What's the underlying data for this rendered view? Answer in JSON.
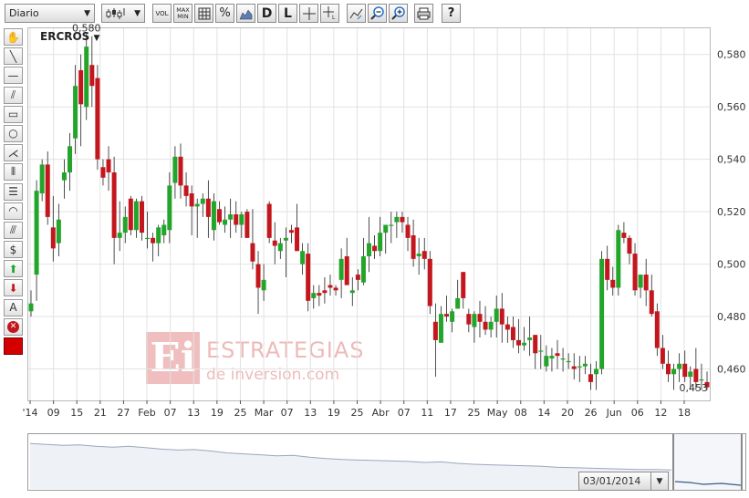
{
  "toolbar": {
    "period_select": "Diario",
    "vol": "VOL",
    "maxmin": "MAX MIN",
    "percent": "%",
    "d": "D",
    "l": "L",
    "help": "?"
  },
  "sidebar_tools": [
    {
      "icon": "hand-icon",
      "glyph": "✋"
    },
    {
      "icon": "trendline-icon",
      "glyph": "╲"
    },
    {
      "icon": "horizontal-line-icon",
      "glyph": "—"
    },
    {
      "icon": "channel-icon",
      "glyph": "⫽"
    },
    {
      "icon": "rectangle-icon",
      "glyph": "▭"
    },
    {
      "icon": "circle-icon",
      "glyph": "○"
    },
    {
      "icon": "pitchfork-icon",
      "glyph": "⋌"
    },
    {
      "icon": "fibonacci-fan-icon",
      "glyph": "⦀"
    },
    {
      "icon": "fibonacci-retracement-icon",
      "glyph": "☰"
    },
    {
      "icon": "arc-icon",
      "glyph": "◠"
    },
    {
      "icon": "parallel-lines-icon",
      "glyph": "⫻"
    },
    {
      "icon": "dollar-lines-icon",
      "glyph": "$"
    },
    {
      "icon": "buy-arrow-icon",
      "glyph": "⬆"
    },
    {
      "icon": "sell-arrow-icon",
      "glyph": "⬇"
    },
    {
      "icon": "text-tool-icon",
      "glyph": "A"
    },
    {
      "icon": "delete-icon",
      "glyph": "✕"
    },
    {
      "icon": "color-picker-icon",
      "glyph": ""
    }
  ],
  "ticker": "ERCROS",
  "watermark": {
    "box": "Ei",
    "line1": "ESTRATEGIAS",
    "line2": "de inversion.com"
  },
  "colors": {
    "up": "#22a52a",
    "down": "#c3161d",
    "grid": "#e2e2e2"
  },
  "chart_data": {
    "type": "candlestick",
    "title": "ERCROS",
    "ylim": [
      0.448,
      0.59
    ],
    "y_ticks": [
      "0,580",
      "0,560",
      "0,540",
      "0,520",
      "0,500",
      "0,480",
      "0,460"
    ],
    "x_labels": [
      "'14",
      "09",
      "15",
      "21",
      "27",
      "Feb",
      "07",
      "13",
      "19",
      "25",
      "Mar",
      "07",
      "13",
      "19",
      "25",
      "Abr",
      "07",
      "11",
      "17",
      "25",
      "May",
      "08",
      "14",
      "20",
      "26",
      "Jun",
      "06",
      "12",
      "18"
    ],
    "annotations": {
      "max": "0,580",
      "last": "0,453"
    },
    "candles": [
      [
        0.482,
        0.49,
        0.48,
        0.485
      ],
      [
        0.496,
        0.532,
        0.486,
        0.528
      ],
      [
        0.527,
        0.54,
        0.524,
        0.538
      ],
      [
        0.538,
        0.543,
        0.515,
        0.518
      ],
      [
        0.514,
        0.526,
        0.501,
        0.506
      ],
      [
        0.508,
        0.523,
        0.503,
        0.517
      ],
      [
        0.532,
        0.54,
        0.525,
        0.535
      ],
      [
        0.535,
        0.55,
        0.528,
        0.545
      ],
      [
        0.548,
        0.576,
        0.542,
        0.568
      ],
      [
        0.574,
        0.58,
        0.545,
        0.561
      ],
      [
        0.56,
        0.588,
        0.555,
        0.583
      ],
      [
        0.576,
        0.587,
        0.56,
        0.568
      ],
      [
        0.571,
        0.576,
        0.536,
        0.54
      ],
      [
        0.537,
        0.54,
        0.53,
        0.533
      ],
      [
        0.54,
        0.545,
        0.528,
        0.535
      ],
      [
        0.535,
        0.541,
        0.5,
        0.51
      ],
      [
        0.51,
        0.524,
        0.505,
        0.512
      ],
      [
        0.512,
        0.522,
        0.508,
        0.518
      ],
      [
        0.525,
        0.526,
        0.511,
        0.513
      ],
      [
        0.513,
        0.525,
        0.51,
        0.524
      ],
      [
        0.524,
        0.526,
        0.509,
        0.512
      ],
      [
        0.51,
        0.52,
        0.506,
        0.51
      ],
      [
        0.51,
        0.512,
        0.501,
        0.508
      ],
      [
        0.508,
        0.515,
        0.503,
        0.514
      ],
      [
        0.511,
        0.517,
        0.508,
        0.515
      ],
      [
        0.513,
        0.535,
        0.508,
        0.53
      ],
      [
        0.531,
        0.545,
        0.525,
        0.541
      ],
      [
        0.541,
        0.546,
        0.525,
        0.53
      ],
      [
        0.53,
        0.535,
        0.522,
        0.526
      ],
      [
        0.527,
        0.53,
        0.511,
        0.522
      ],
      [
        0.522,
        0.525,
        0.51,
        0.523
      ],
      [
        0.523,
        0.527,
        0.518,
        0.525
      ],
      [
        0.525,
        0.532,
        0.51,
        0.518
      ],
      [
        0.513,
        0.527,
        0.509,
        0.524
      ],
      [
        0.521,
        0.524,
        0.515,
        0.516
      ],
      [
        0.515,
        0.522,
        0.512,
        0.517
      ],
      [
        0.517,
        0.525,
        0.51,
        0.519
      ],
      [
        0.519,
        0.524,
        0.512,
        0.515
      ],
      [
        0.515,
        0.52,
        0.51,
        0.519
      ],
      [
        0.52,
        0.521,
        0.51,
        0.51
      ],
      [
        0.508,
        0.521,
        0.498,
        0.501
      ],
      [
        0.5,
        0.505,
        0.481,
        0.491
      ],
      [
        0.49,
        0.5,
        0.486,
        0.494
      ],
      [
        0.523,
        0.524,
        0.508,
        0.51
      ],
      [
        0.509,
        0.516,
        0.5,
        0.507
      ],
      [
        0.505,
        0.51,
        0.502,
        0.508
      ],
      [
        0.509,
        0.514,
        0.495,
        0.51
      ],
      [
        0.513,
        0.515,
        0.508,
        0.512
      ],
      [
        0.514,
        0.523,
        0.505,
        0.505
      ],
      [
        0.5,
        0.508,
        0.496,
        0.505
      ],
      [
        0.504,
        0.508,
        0.482,
        0.486
      ],
      [
        0.487,
        0.492,
        0.483,
        0.489
      ],
      [
        0.489,
        0.492,
        0.484,
        0.488
      ],
      [
        0.49,
        0.495,
        0.485,
        0.489
      ],
      [
        0.492,
        0.496,
        0.488,
        0.491
      ],
      [
        0.491,
        0.492,
        0.488,
        0.49
      ],
      [
        0.494,
        0.506,
        0.487,
        0.502
      ],
      [
        0.503,
        0.51,
        0.5,
        0.492
      ],
      [
        0.489,
        0.495,
        0.484,
        0.49
      ],
      [
        0.496,
        0.498,
        0.49,
        0.494
      ],
      [
        0.493,
        0.51,
        0.492,
        0.503
      ],
      [
        0.503,
        0.518,
        0.497,
        0.508
      ],
      [
        0.507,
        0.511,
        0.502,
        0.505
      ],
      [
        0.505,
        0.518,
        0.503,
        0.512
      ],
      [
        0.512,
        0.515,
        0.504,
        0.515
      ],
      [
        0.515,
        0.52,
        0.508,
        0.515
      ],
      [
        0.516,
        0.52,
        0.51,
        0.518
      ],
      [
        0.518,
        0.52,
        0.512,
        0.516
      ],
      [
        0.515,
        0.518,
        0.505,
        0.51
      ],
      [
        0.511,
        0.517,
        0.499,
        0.502
      ],
      [
        0.503,
        0.51,
        0.496,
        0.504
      ],
      [
        0.505,
        0.51,
        0.498,
        0.502
      ],
      [
        0.502,
        0.505,
        0.481,
        0.484
      ],
      [
        0.478,
        0.485,
        0.457,
        0.471
      ],
      [
        0.47,
        0.484,
        0.47,
        0.481
      ],
      [
        0.481,
        0.488,
        0.478,
        0.48
      ],
      [
        0.478,
        0.483,
        0.474,
        0.482
      ],
      [
        0.483,
        0.494,
        0.483,
        0.487
      ],
      [
        0.497,
        0.497,
        0.483,
        0.487
      ],
      [
        0.481,
        0.483,
        0.474,
        0.477
      ],
      [
        0.476,
        0.482,
        0.47,
        0.481
      ],
      [
        0.481,
        0.486,
        0.472,
        0.478
      ],
      [
        0.478,
        0.484,
        0.473,
        0.475
      ],
      [
        0.475,
        0.48,
        0.472,
        0.478
      ],
      [
        0.478,
        0.488,
        0.472,
        0.483
      ],
      [
        0.483,
        0.489,
        0.47,
        0.477
      ],
      [
        0.477,
        0.48,
        0.47,
        0.475
      ],
      [
        0.476,
        0.48,
        0.468,
        0.471
      ],
      [
        0.471,
        0.479,
        0.466,
        0.469
      ],
      [
        0.469,
        0.476,
        0.467,
        0.47
      ],
      [
        0.471,
        0.48,
        0.465,
        0.472
      ],
      [
        0.473,
        0.473,
        0.46,
        0.466
      ],
      [
        0.467,
        0.473,
        0.46,
        0.467
      ],
      [
        0.461,
        0.469,
        0.459,
        0.465
      ],
      [
        0.464,
        0.468,
        0.459,
        0.465
      ],
      [
        0.466,
        0.471,
        0.46,
        0.465
      ],
      [
        0.464,
        0.468,
        0.459,
        0.464
      ],
      [
        0.463,
        0.466,
        0.46,
        0.463
      ],
      [
        0.461,
        0.466,
        0.456,
        0.46
      ],
      [
        0.461,
        0.465,
        0.455,
        0.461
      ],
      [
        0.461,
        0.465,
        0.458,
        0.462
      ],
      [
        0.458,
        0.462,
        0.452,
        0.455
      ],
      [
        0.458,
        0.463,
        0.452,
        0.46
      ],
      [
        0.46,
        0.505,
        0.458,
        0.502
      ],
      [
        0.502,
        0.507,
        0.49,
        0.494
      ],
      [
        0.494,
        0.499,
        0.488,
        0.491
      ],
      [
        0.491,
        0.515,
        0.488,
        0.513
      ],
      [
        0.512,
        0.516,
        0.508,
        0.51
      ],
      [
        0.51,
        0.511,
        0.5,
        0.504
      ],
      [
        0.504,
        0.508,
        0.488,
        0.49
      ],
      [
        0.491,
        0.496,
        0.487,
        0.496
      ],
      [
        0.496,
        0.502,
        0.484,
        0.49
      ],
      [
        0.49,
        0.496,
        0.48,
        0.481
      ],
      [
        0.482,
        0.485,
        0.465,
        0.468
      ],
      [
        0.468,
        0.473,
        0.46,
        0.462
      ],
      [
        0.462,
        0.467,
        0.455,
        0.458
      ],
      [
        0.458,
        0.462,
        0.452,
        0.46
      ],
      [
        0.46,
        0.466,
        0.455,
        0.462
      ],
      [
        0.462,
        0.467,
        0.455,
        0.457
      ],
      [
        0.457,
        0.461,
        0.452,
        0.459
      ],
      [
        0.46,
        0.468,
        0.452,
        0.455
      ],
      [
        0.456,
        0.462,
        0.452,
        0.456
      ],
      [
        0.455,
        0.459,
        0.452,
        0.453
      ]
    ]
  },
  "navigator": {
    "date": "03/01/2014",
    "history": [
      0.92,
      0.9,
      0.88,
      0.89,
      0.86,
      0.84,
      0.86,
      0.83,
      0.8,
      0.78,
      0.79,
      0.76,
      0.72,
      0.7,
      0.68,
      0.66,
      0.67,
      0.63,
      0.6,
      0.58,
      0.57,
      0.56,
      0.55,
      0.54,
      0.52,
      0.53,
      0.5,
      0.48,
      0.47,
      0.46,
      0.45,
      0.44,
      0.42,
      0.41,
      0.4,
      0.39,
      0.38,
      0.37,
      0.37,
      0.36
    ]
  }
}
